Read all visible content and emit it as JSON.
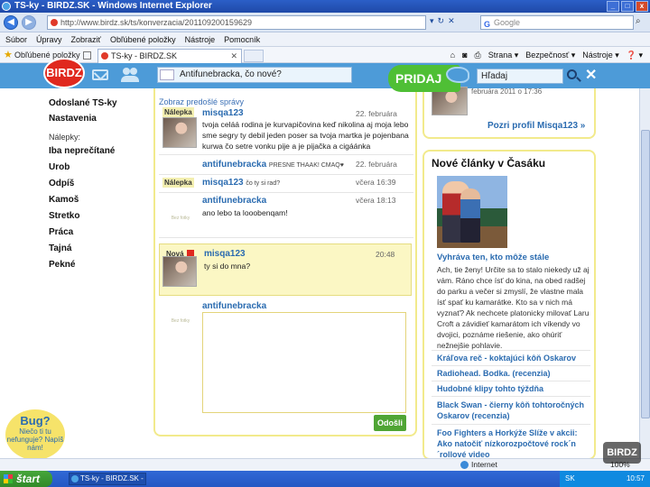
{
  "window": {
    "title": "TS-ky - BIRDZ.SK - Windows Internet Explorer"
  },
  "addressbar": {
    "url": "http://www.birdz.sk/ts/konverzacia/201109200159629",
    "search_placeholder": "Google"
  },
  "menubar": {
    "items": [
      "Súbor",
      "Úpravy",
      "Zobraziť",
      "Obľúbené položky",
      "Nástroje",
      "Pomocník"
    ]
  },
  "favorites": {
    "label": "Obľúbené položky",
    "tab_title": "TS-ky - BIRDZ.SK",
    "commands": [
      "Strana ▾",
      "Bezpečnosť ▾",
      "Nástroje ▾",
      "❓ ▾"
    ]
  },
  "site": {
    "logo_text": "BIRDZ",
    "status_value": "Antifunebracka, čo nové?",
    "pridaj_label": "PRIDAJ",
    "search_placeholder": "Hľadaj",
    "close_glyph": "✕"
  },
  "left_nav": {
    "items": [
      "Odoslané TS-ky",
      "Nastavenia"
    ],
    "labels_heading": "Nálepky:",
    "labels": [
      "Iba neprečítané",
      "Urob",
      "Odpíš",
      "Kamoš",
      "Stretko",
      "Práca",
      "Tajná",
      "Pekné"
    ]
  },
  "bug": {
    "title": "Bug?",
    "text": "Niečo ti tu nefunguje? Napíš nám!"
  },
  "conversation": {
    "prev_link": "Zobraz predošlé správy",
    "messages": [
      {
        "badge": "Nálepka",
        "sender": "misqa123",
        "inline": "",
        "date": "22. februára",
        "text": "tvoja celáá rodina je kurvapičovina keď nikolina aj moja lebo sme segry ty debil jeden poser sa tvoja martka je pojenbana kurwa čo setre vonku pije a je pijačka a cigáánka"
      },
      {
        "badge": "",
        "sender": "antifunebracka",
        "inline": "PRESNE THAAK! CMAQ♥",
        "date": "22. februára",
        "text": ""
      },
      {
        "badge": "Nálepka",
        "sender": "misqa123",
        "inline": "čo ty si rad?",
        "date": "včera 16:39",
        "text": ""
      },
      {
        "badge": "",
        "sender": "antifunebracka",
        "inline": "",
        "date": "včera 18:13",
        "text": "ano lebo ta looobenqam!"
      },
      {
        "badge": "Nová",
        "sender": "misqa123",
        "inline": "",
        "date": "20:48",
        "text": "ty si do mna?"
      }
    ],
    "reply_sender": "antifunebracka",
    "reply_value": "",
    "send_label": "Odošli",
    "logo_caption": "Bez fotky"
  },
  "profile": {
    "date": "februára 2011 o 17:36",
    "link": "Pozri profil Misqa123 »"
  },
  "articles": {
    "title": "Nové články v Časáku",
    "featured_title": "Vyhráva ten, kto môže stále",
    "featured_text": "Ach, tie ženy! Určite sa to stalo niekedy už aj vám. Ráno chce ísť do kina, na obed radšej do parku a večer si zmyslí, že vlastne mala ísť spať ku kamarátke. Kto sa v nich má vyznať? Ak nechcete platonicky milovať Laru Croft a závidieť kamarátom ich víkendy vo dvojici, poznáme riešenie, ako ohúriť nežnejšie pohlavie.",
    "links": [
      "Kráľova reč - koktajúci kôň Oskarov",
      "Radiohead. Bodka. (recenzia)",
      "Hudobné klipy tohto týždňa",
      "Black Swan - čierny kôň tohtoročných Oskarov (recenzia)",
      "Foo Fighters a Horkýže Slíže v akcii: Ako natočiť nízkorozpočtové rock´n´rollové video"
    ]
  },
  "statusbar": {
    "zone": "Internet",
    "zoom": "100%"
  },
  "taskbar": {
    "start_label": "štart",
    "task_label": "TS-ky - BIRDZ.SK - W...",
    "lang": "SK",
    "clock": "10:57"
  },
  "watermark": "BIRDZ"
}
